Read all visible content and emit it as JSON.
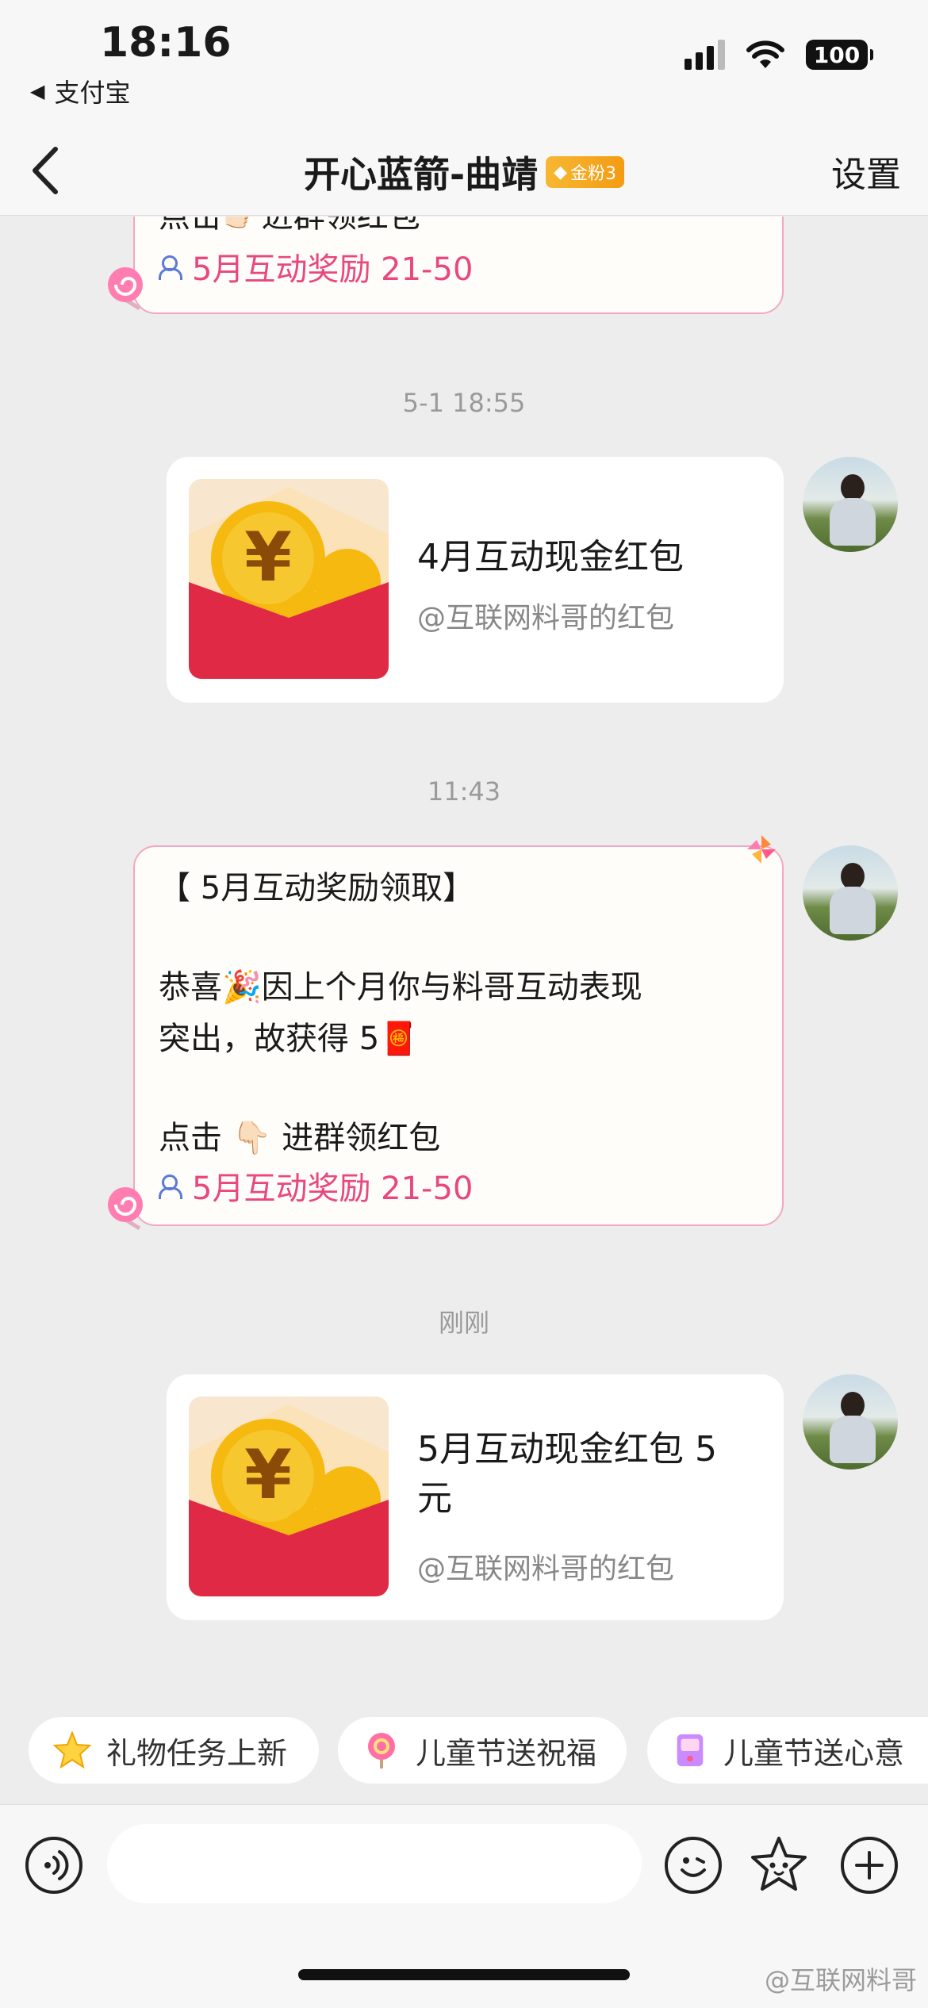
{
  "status_bar": {
    "time": "18:16",
    "back_app": "支付宝",
    "battery": "100"
  },
  "nav": {
    "title": "开心蓝箭-曲靖",
    "fan_badge": "金粉3",
    "settings_label": "设置"
  },
  "chat": {
    "top_partial": {
      "click_text": "点击👉🏻进群领红包",
      "group_link": "5月互动奖励 21-50"
    },
    "timestamps": [
      "5-1 18:55",
      "11:43",
      "刚刚"
    ],
    "red_packet_1": {
      "title": "4月互动现金红包",
      "subtitle": "@互联网料哥的红包"
    },
    "reward_msg": {
      "heading": "【 5月互动奖励领取】",
      "body_line1": "恭喜🎉因上个月你与料哥互动表现",
      "body_line2": "突出，故获得 5🧧",
      "click_text": "点击 👇🏻 进群领红包",
      "group_link": "5月互动奖励 21-50"
    },
    "red_packet_2": {
      "title_line1": "5月互动现金红包 5",
      "title_line2": "元",
      "subtitle": "@互联网料哥的红包"
    }
  },
  "chips": [
    {
      "label": "礼物任务上新",
      "icon": "star-icon"
    },
    {
      "label": "儿童节送祝福",
      "icon": "lollipop-icon"
    },
    {
      "label": "儿童节送心意",
      "icon": "arcade-icon"
    }
  ],
  "watermark": "@互联网料哥",
  "colors": {
    "accent_pink": "#e8487e",
    "envelope_red": "#e02a45",
    "coin_gold": "#f5b90f"
  }
}
